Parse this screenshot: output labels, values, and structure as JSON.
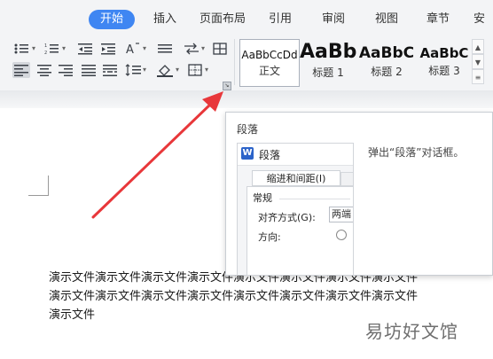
{
  "ribbon": {
    "tabs": [
      {
        "label": "开始",
        "active": true
      },
      {
        "label": "插入"
      },
      {
        "label": "页面布局"
      },
      {
        "label": "引用"
      },
      {
        "label": "审阅"
      },
      {
        "label": "视图"
      },
      {
        "label": "章节"
      },
      {
        "label": "安"
      }
    ]
  },
  "toolbar": {
    "paragraph_icons": [
      "bullet-list-icon",
      "numbered-list-icon",
      "decrease-indent-icon",
      "increase-indent-icon",
      "chinese-layout-icon",
      "line-spacing-direction-icon",
      "table-border-icon",
      "align-left-icon",
      "align-center-icon",
      "align-right-icon",
      "justify-icon",
      "distributed-icon",
      "line-spacing-icon",
      "shading-icon",
      "borders-icon"
    ],
    "styles": [
      {
        "sample": "AaBbCcDd",
        "label": "正文"
      },
      {
        "sample": "AaBb",
        "label": "标题 1"
      },
      {
        "sample": "AaBbC",
        "label": "标题 2"
      },
      {
        "sample": "AaBbC",
        "label": "标题 3"
      }
    ],
    "launcher_icon": "dialog-launcher-icon"
  },
  "tooltip": {
    "title": "段落",
    "description": "弹出“段落”对话框。",
    "preview": {
      "dialog_title": "段落",
      "tab_label": "缩进和间距(I)",
      "section": "常规",
      "align_label": "对齐方式(G):",
      "align_value": "两端",
      "direction_label": "方向:"
    }
  },
  "document": {
    "text": "演示文件演示文件演示文件演示文件演示文件演示文件演示文件演示文件演示文件演示文件演示文件演示文件演示文件演示文件演示文件演示文件演示文件"
  },
  "watermark": "易坊好文馆",
  "colors": {
    "accent": "#3f86f2",
    "arrow": "#e8373a"
  }
}
